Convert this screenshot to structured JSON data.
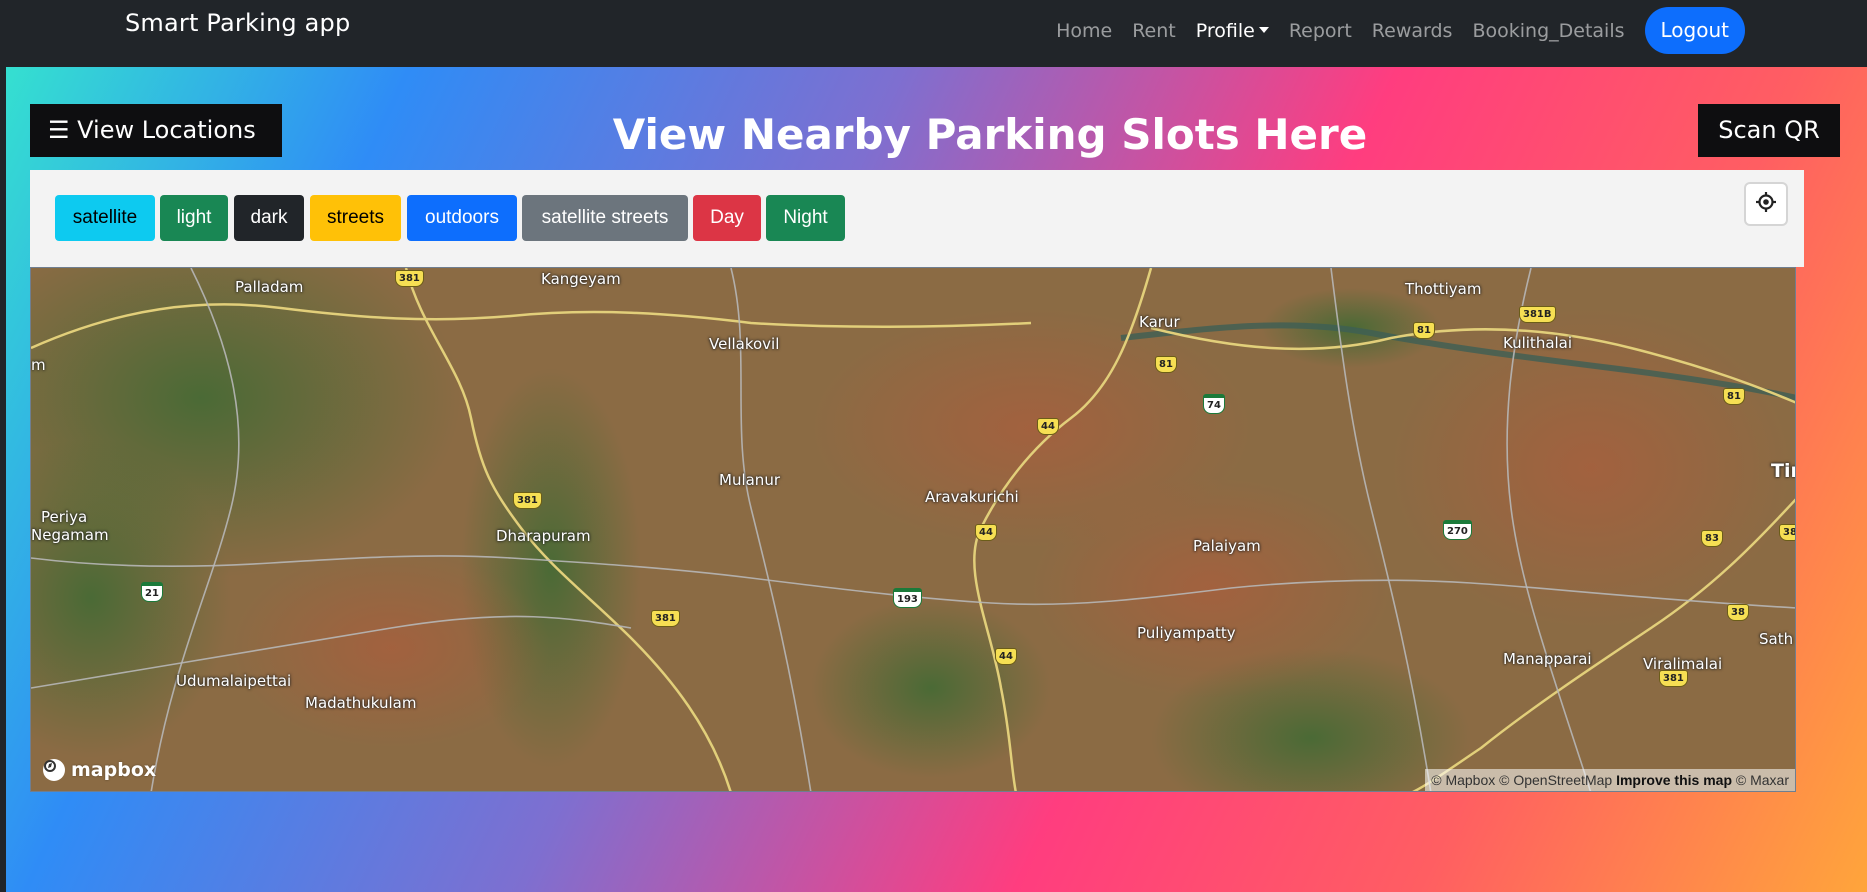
{
  "navbar": {
    "brand": "Smart Parking app",
    "links": [
      "Home",
      "Rent",
      "Profile",
      "Report",
      "Rewards",
      "Booking_Details"
    ],
    "logout": "Logout"
  },
  "page": {
    "view_locations": "☰ View Locations",
    "title": "View Nearby Parking Slots Here",
    "scan_qr": "Scan QR"
  },
  "styles": [
    {
      "label": "satellite",
      "bg": "#0dcaf0",
      "fg": "#000000"
    },
    {
      "label": "light",
      "bg": "#198754",
      "fg": "#ffffff"
    },
    {
      "label": "dark",
      "bg": "#212529",
      "fg": "#ffffff"
    },
    {
      "label": "streets",
      "bg": "#ffc107",
      "fg": "#000000"
    },
    {
      "label": "outdoors",
      "bg": "#0d6efd",
      "fg": "#ffffff"
    },
    {
      "label": "satellite streets",
      "bg": "#6c757d",
      "fg": "#ffffff"
    },
    {
      "label": "Day",
      "bg": "#dc3545",
      "fg": "#ffffff"
    },
    {
      "label": "Night",
      "bg": "#198754",
      "fg": "#ffffff"
    }
  ],
  "map": {
    "places": [
      "Palladam",
      "Kangeyam",
      "Vellakovil",
      "Karur",
      "Thottiyam",
      "Kulithalai",
      "Mulanur",
      "Aravakurichi",
      "Dharapuram",
      "Periya",
      "Negamam",
      "Palaiyam",
      "Puliyampatty",
      "Udumalaipettai",
      "Madathukulam",
      "Manapparai",
      "Viralimalai",
      "Tir",
      "Sath",
      "m"
    ],
    "shields": [
      "381",
      "381",
      "381",
      "381",
      "81",
      "81",
      "81",
      "381B",
      "44",
      "44",
      "44",
      "74",
      "270",
      "193",
      "21",
      "83",
      "38",
      "38"
    ],
    "logo": "mapbox",
    "attribution": {
      "mapbox": "© Mapbox",
      "osm": "© OpenStreetMap",
      "improve": "Improve this map",
      "maxar": "© Maxar"
    }
  }
}
